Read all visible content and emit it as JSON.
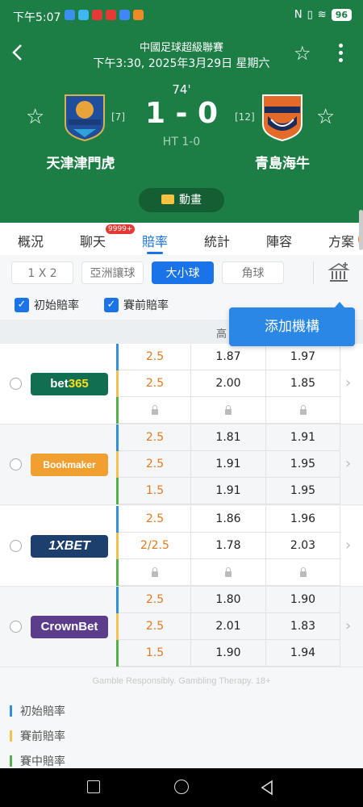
{
  "status": {
    "time": "下午5:07",
    "battery": "96"
  },
  "match": {
    "league": "中國足球超級聯賽",
    "datetime": "下午3:30, 2025年3月29日 星期六",
    "minute": "74'",
    "score": "1 - 0",
    "ht": "HT 1-0",
    "home": {
      "name": "天津津門虎",
      "rank": "[7]"
    },
    "away": {
      "name": "青島海牛",
      "rank": "[12]"
    },
    "animation_label": "動畫"
  },
  "tabs": [
    {
      "label": "概況"
    },
    {
      "label": "聊天",
      "badge": "9999+"
    },
    {
      "label": "賠率"
    },
    {
      "label": "統計"
    },
    {
      "label": "陣容"
    },
    {
      "label": "方案"
    }
  ],
  "filters": [
    "1 X 2",
    "亞洲讓球",
    "大小球",
    "角球"
  ],
  "checks": {
    "initial": "初始賠率",
    "pre": "賽前賠率"
  },
  "tooltip": "添加機構",
  "columns": {
    "over": "高"
  },
  "bookmakers": [
    {
      "name": "bet365",
      "rows": [
        {
          "line": "2.5",
          "o": "1.87",
          "u": "1.97"
        },
        {
          "line": "2.5",
          "o": "2.00",
          "u": "1.85"
        },
        {
          "line": "",
          "o": "",
          "u": ""
        }
      ]
    },
    {
      "name": "Bookmaker",
      "rows": [
        {
          "line": "2.5",
          "o": "1.81",
          "u": "1.91"
        },
        {
          "line": "2.5",
          "o": "1.91",
          "u": "1.95"
        },
        {
          "line": "1.5",
          "o": "1.91",
          "u": "1.95"
        }
      ]
    },
    {
      "name": "1XBET",
      "rows": [
        {
          "line": "2.5",
          "o": "1.86",
          "u": "1.96"
        },
        {
          "line": "2/2.5",
          "o": "1.78",
          "u": "2.03"
        },
        {
          "line": "",
          "o": "",
          "u": ""
        }
      ]
    },
    {
      "name": "CrownBet",
      "rows": [
        {
          "line": "2.5",
          "o": "1.80",
          "u": "1.90"
        },
        {
          "line": "2.5",
          "o": "2.01",
          "u": "1.83"
        },
        {
          "line": "1.5",
          "o": "1.90",
          "u": "1.94"
        }
      ]
    }
  ],
  "disclaimer": "Gamble Responsibly. Gambling Therapy. 18+",
  "legend": [
    "初始賠率",
    "賽前賠率",
    "賽中賠率"
  ],
  "colors": {
    "header": "#1c7d45",
    "accent": "#1a73e8",
    "initial": "#2f8fe0",
    "pre": "#f2c14e",
    "live": "#55b04a",
    "line": "#e07a1f"
  }
}
